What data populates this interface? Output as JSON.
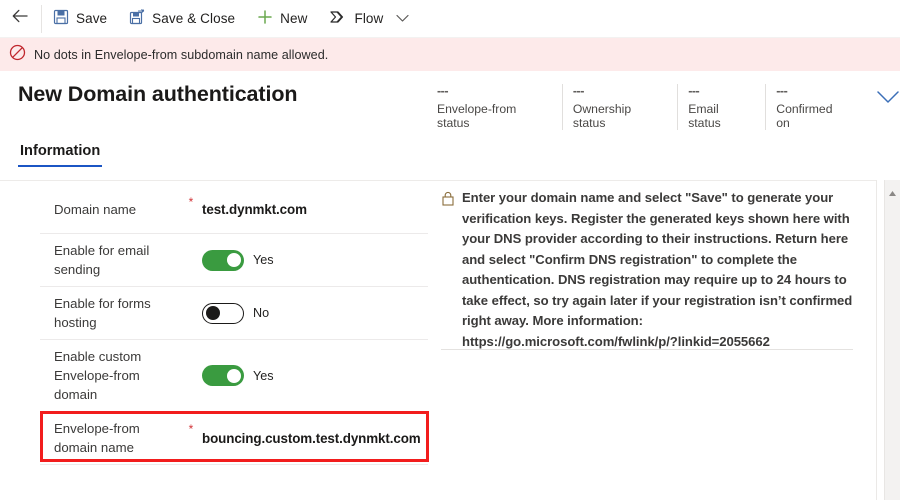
{
  "commandbar": {
    "back_icon": "arrow-left-icon",
    "items": [
      {
        "label": "Save",
        "icon": "save-floppy-icon"
      },
      {
        "label": "Save & Close",
        "icon": "save-and-close-icon"
      },
      {
        "label": "New",
        "icon": "plus-icon"
      },
      {
        "label": "Flow",
        "icon": "flow-icon"
      }
    ],
    "overflow_icon": "chevron-down-icon"
  },
  "notification": {
    "icon": "block-prohibited-icon",
    "message": "No dots in Envelope-from subdomain name allowed.",
    "background": "#fdeaea",
    "icon_color": "#c0272d"
  },
  "header": {
    "title": "New Domain authentication",
    "status_fields": [
      {
        "value": "---",
        "label": "Envelope-from status"
      },
      {
        "value": "---",
        "label": "Ownership status"
      },
      {
        "value": "---",
        "label": "Email status"
      },
      {
        "value": "---",
        "label": "Confirmed on"
      }
    ],
    "expand_icon": "chevron-down-icon"
  },
  "tabs": [
    {
      "label": "Information",
      "active": true
    }
  ],
  "form": {
    "fields": [
      {
        "label": "Domain name",
        "required": "*",
        "type": "text",
        "value": "test.dynmkt.com"
      },
      {
        "label": "Enable for email sending",
        "required": "",
        "type": "toggle",
        "state": "on",
        "value": "Yes"
      },
      {
        "label": "Enable for forms hosting",
        "required": "",
        "type": "toggle",
        "state": "off",
        "value": "No"
      },
      {
        "label": "Enable custom Envelope-from domain",
        "required": "",
        "type": "toggle",
        "state": "on",
        "value": "Yes"
      },
      {
        "label": "Envelope-from domain name",
        "required": "*",
        "type": "text",
        "value": "bouncing.custom.test.dynmkt.com",
        "highlighted": true
      }
    ],
    "highlight_color": "#f21d1d",
    "toggle_on_color": "#3a9b40",
    "required_color": "#d13438"
  },
  "info_panel": {
    "icon": "lock-icon",
    "text": "Enter your domain name and select \"Save\" to generate your verification keys. Register the generated keys shown here with your DNS provider according to their instructions. Return here and select \"Confirm DNS registration\" to complete the authentication. DNS registration may require up to 24 hours to take effect, so try again later if your registration isn’t confirmed right away. More information: https://go.microsoft.com/fwlink/p/?linkid=2055662"
  },
  "scrollbar": {
    "up_arrow_icon": "scroll-up-arrow-icon"
  },
  "theme": {
    "accent": "#1b55c4",
    "text": "#201f1e",
    "muted": "#605e5c"
  }
}
